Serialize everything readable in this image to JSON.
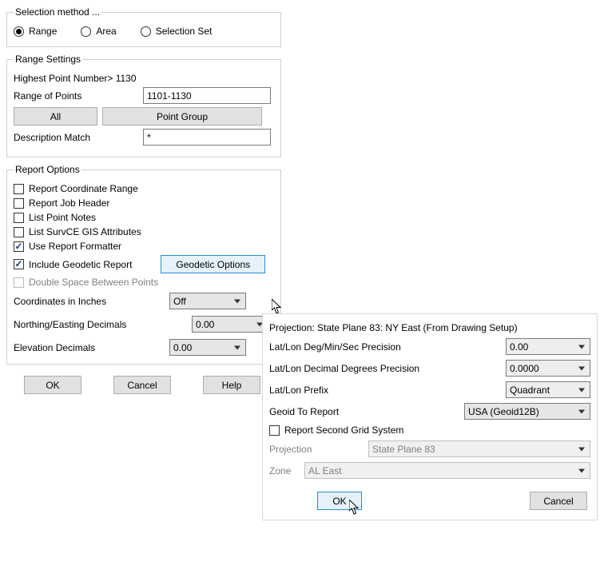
{
  "selection": {
    "legend": "Selection method ...",
    "options": {
      "range": "Range",
      "area": "Area",
      "set": "Selection Set"
    },
    "selected": "range"
  },
  "rangeSettings": {
    "legend": "Range Settings",
    "highestLabel": "Highest Point Number> 1130",
    "rangeLabel": "Range of Points",
    "rangeValue": "1101-1130",
    "allBtn": "All",
    "pointGroupBtn": "Point Group",
    "descMatchLabel": "Description Match",
    "descMatchValue": "*"
  },
  "reportOptions": {
    "legend": "Report Options",
    "items": {
      "coordRange": "Report Coordinate Range",
      "jobHeader": "Report Job Header",
      "pointNotes": "List Point Notes",
      "gisAttrs": "List SurvCE GIS Attributes",
      "useFormatter": "Use Report Formatter",
      "includeGeodetic": "Include Geodetic Report",
      "doubleSpace": "Double Space Between Points"
    },
    "geodeticBtn": "Geodetic Options",
    "coordsInchesLabel": "Coordinates in Inches",
    "coordsInchesValue": "Off",
    "neDecimalsLabel": "Northing/Easting Decimals",
    "neDecimalsValue": "0.00",
    "elevDecimalsLabel": "Elevation Decimals",
    "elevDecimalsValue": "0.00"
  },
  "mainButtons": {
    "ok": "OK",
    "cancel": "Cancel",
    "help": "Help"
  },
  "popup": {
    "projectionLine": "Projection: State Plane 83: NY East (From Drawing Setup)",
    "dmsPrecLabel": "Lat/Lon Deg/Min/Sec Precision",
    "dmsPrecValue": "0.00",
    "ddPrecLabel": "Lat/Lon Decimal Degrees Precision",
    "ddPrecValue": "0.0000",
    "prefixLabel": "Lat/Lon Prefix",
    "prefixValue": "Quadrant",
    "geoidLabel": "Geoid To Report",
    "geoidValue": "USA (Geoid12B)",
    "secondGridLabel": "Report Second Grid System",
    "projLabel": "Projection",
    "projValue": "State Plane 83",
    "zoneLabel": "Zone",
    "zoneValue": "AL East",
    "ok": "OK",
    "cancel": "Cancel"
  }
}
